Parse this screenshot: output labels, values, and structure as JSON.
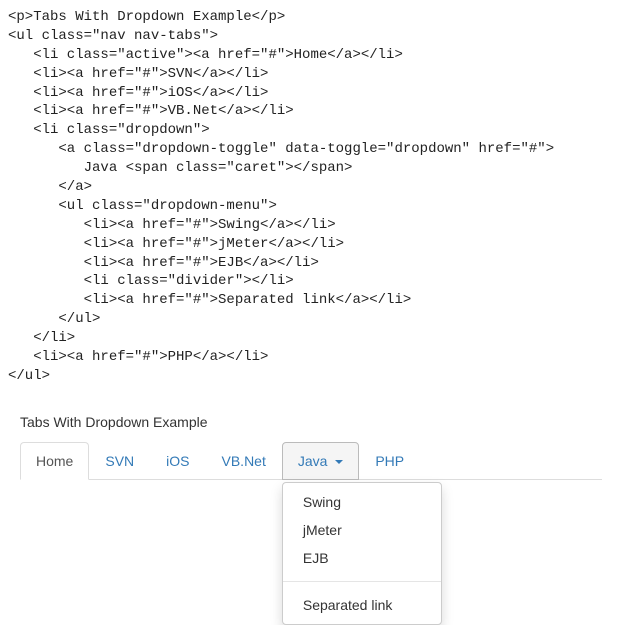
{
  "code_lines": [
    "<p>Tabs With Dropdown Example</p>",
    "<ul class=\"nav nav-tabs\">",
    "   <li class=\"active\"><a href=\"#\">Home</a></li>",
    "   <li><a href=\"#\">SVN</a></li>",
    "   <li><a href=\"#\">iOS</a></li>",
    "   <li><a href=\"#\">VB.Net</a></li>",
    "   <li class=\"dropdown\">",
    "      <a class=\"dropdown-toggle\" data-toggle=\"dropdown\" href=\"#\">",
    "         Java <span class=\"caret\"></span>",
    "      </a>",
    "      <ul class=\"dropdown-menu\">",
    "         <li><a href=\"#\">Swing</a></li>",
    "         <li><a href=\"#\">jMeter</a></li>",
    "         <li><a href=\"#\">EJB</a></li>",
    "         <li class=\"divider\"></li>",
    "         <li><a href=\"#\">Separated link</a></li>",
    "      </ul>",
    "   </li>",
    "   <li><a href=\"#\">PHP</a></li>",
    "</ul>"
  ],
  "title": "Tabs With Dropdown Example",
  "tabs": {
    "home": "Home",
    "svn": "SVN",
    "ios": "iOS",
    "vbnet": "VB.Net",
    "java": "Java",
    "php": "PHP"
  },
  "dropdown": {
    "swing": "Swing",
    "jmeter": "jMeter",
    "ejb": "EJB",
    "separated": "Separated link"
  }
}
